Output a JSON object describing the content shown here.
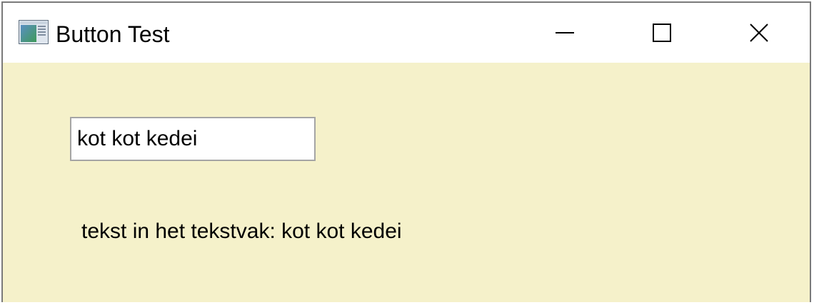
{
  "window": {
    "title": "Button Test",
    "controls": {
      "minimize": "minimize-icon",
      "maximize": "maximize-icon",
      "close": "close-icon"
    }
  },
  "content": {
    "textbox_value": "kot kot kedei",
    "output_label": "tekst in het tekstvak: kot kot kedei"
  },
  "colors": {
    "client_background": "#f5f1ca",
    "titlebar_background": "#ffffff",
    "textbox_border": "#a5a5a5"
  }
}
